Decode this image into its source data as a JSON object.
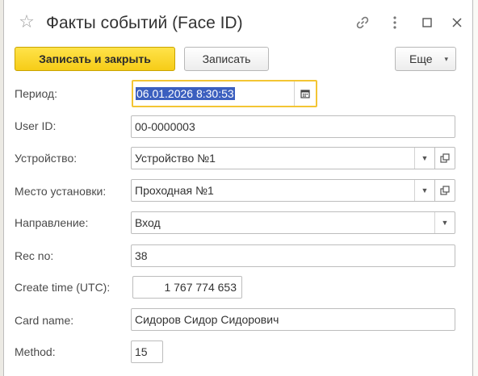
{
  "window": {
    "title": "Факты событий (Face ID)",
    "icons": [
      "star-icon",
      "link-icon",
      "more-vertical-icon",
      "maximize-icon",
      "close-icon"
    ]
  },
  "toolbar": {
    "save_close_label": "Записать и закрыть",
    "save_label": "Записать",
    "more_label": "Еще",
    "more_caret": "▾"
  },
  "form": {
    "period": {
      "label": "Период:",
      "value": "06.01.2026  8:30:53"
    },
    "user_id": {
      "label": "User ID:",
      "value": "00-0000003"
    },
    "device": {
      "label": "Устройство:",
      "value": "Устройство №1"
    },
    "location": {
      "label": "Место установки:",
      "value": "Проходная №1"
    },
    "direction": {
      "label": "Направление:",
      "value": "Вход"
    },
    "rec_no": {
      "label": "Rec no:",
      "value": "38"
    },
    "create_time": {
      "label": "Create time (UTC):",
      "value": "1 767 774 653"
    },
    "card_name": {
      "label": "Card name:",
      "value": "Сидоров Сидор Сидорович"
    },
    "method": {
      "label": "Method:",
      "value": "15"
    }
  },
  "colors": {
    "primary_button": "#f6cc17",
    "focus_border": "#f3c534",
    "selection": "#3b5fbf"
  }
}
